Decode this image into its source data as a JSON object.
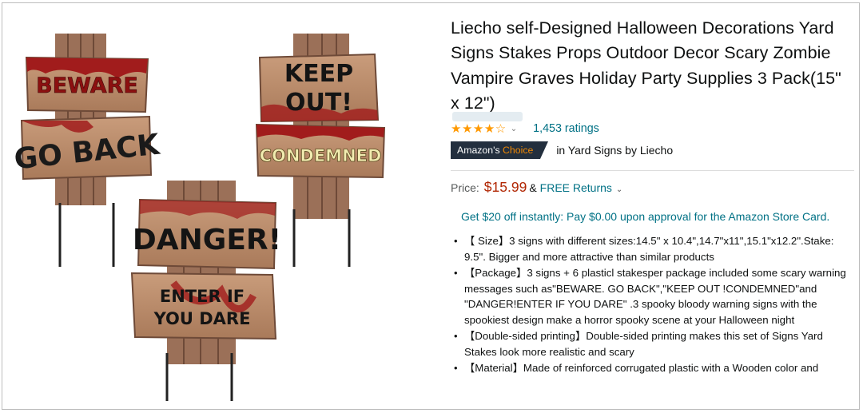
{
  "product": {
    "image_alt": "Halloween yard signs: BEWARE GO BACK, KEEP OUT! CONDEMNED, DANGER! ENTER IF YOU DARE",
    "sign_texts": [
      "BEWARE",
      "GO BACK",
      "KEEP OUT!",
      "CONDEMNED",
      "DANGER!",
      "ENTER IF YOU DARE"
    ],
    "title": "Liecho self-Designed Halloween Decorations Yard Signs Stakes Props Outdoor Decor Scary Zombie Vampire Graves Holiday Party Supplies 3 Pack(15\" x 12\")",
    "rating": {
      "stars": "★★★★☆",
      "ratings_count": "1,453 ratings"
    },
    "badge": {
      "prefix": "Amazon's ",
      "accent": "Choice",
      "text": "in Yard Signs by Liecho"
    },
    "price": {
      "label": "Price:",
      "amount": "$15.99",
      "amp": "&",
      "free_returns": "FREE Returns"
    },
    "promo": "Get $20 off instantly: Pay $0.00 upon approval for the Amazon Store Card.",
    "bullets": [
      "【 Size】3 signs with different sizes:14.5\" x 10.4\",14.7\"x11\",15.1\"x12.2\".Stake: 9.5\". Bigger and more attractive than similar products",
      "【Package】3 signs + 6 plasticl stakesper package included some scary warning messages such as\"BEWARE. GO BACK\",\"KEEP OUT !CONDEMNED\"and \"DANGER!ENTER IF YOU DARE\" .3 spooky bloody warning signs with the spookiest design make a horror spooky scene at your Halloween night",
      "【Double-sided printing】Double-sided printing makes this set of Signs Yard Stakes look more realistic and scary",
      "【Material】Made of reinforced corrugated plastic with a Wooden color and"
    ]
  },
  "colors": {
    "link": "#007185",
    "price": "#b12704",
    "star": "#ff9900",
    "badge_bg": "#232f3e",
    "badge_accent": "#f08804",
    "wood": "#b9896a",
    "blood": "#a11c1c"
  }
}
